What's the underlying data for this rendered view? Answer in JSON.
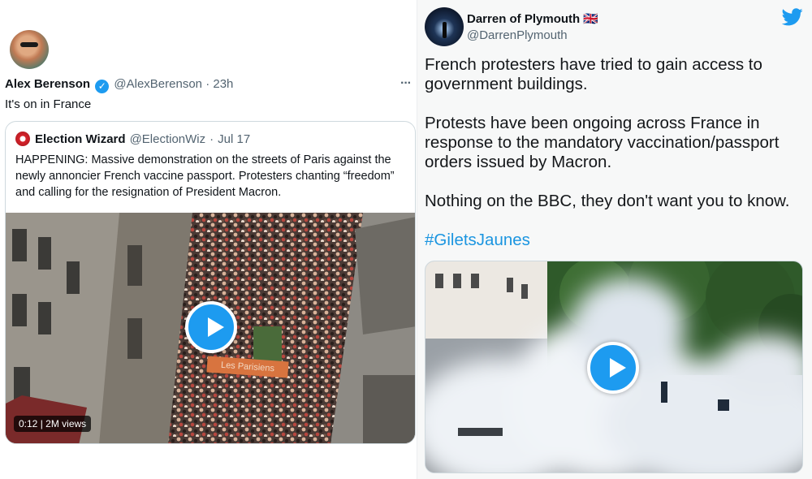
{
  "left_tweet": {
    "author_name": "Alex Berenson",
    "verified_glyph": "✓",
    "handle": "@AlexBerenson",
    "separator": "·",
    "time": "23h",
    "more_glyph": "···",
    "text": "It's on in France",
    "quoted": {
      "author_name": "Election Wizard",
      "handle": "@ElectionWiz",
      "separator": "·",
      "date": "Jul 17",
      "text": "HAPPENING: Massive demonstration on the streets of Paris against the newly annoncier French vaccine passport. Protesters chanting “freedom” and calling for the resignation of President Macron.",
      "video_duration": "0:12",
      "video_separator": "|",
      "video_views": "2M views",
      "banner_text": "Les Parisiens"
    }
  },
  "right_tweet": {
    "author_name": "Darren of Plymouth",
    "flag_glyph": "🇬🇧",
    "handle": "@DarrenPlymouth",
    "paragraph1": "French protesters have tried to gain access to government buildings.",
    "paragraph2": "Protests have been ongoing across France in response to the mandatory vaccination/passport orders issued by Macron.",
    "paragraph3": "Nothing on the BBC, they don't want you to know.",
    "hashtag": "#GiletsJaunes"
  },
  "colors": {
    "accent": "#1d9bf0",
    "muted": "#536471",
    "hashtag": "#1b95e0"
  },
  "icons": [
    "verified-badge-icon",
    "more-options-icon",
    "play-icon",
    "twitter-bird-icon",
    "uk-flag-icon"
  ]
}
